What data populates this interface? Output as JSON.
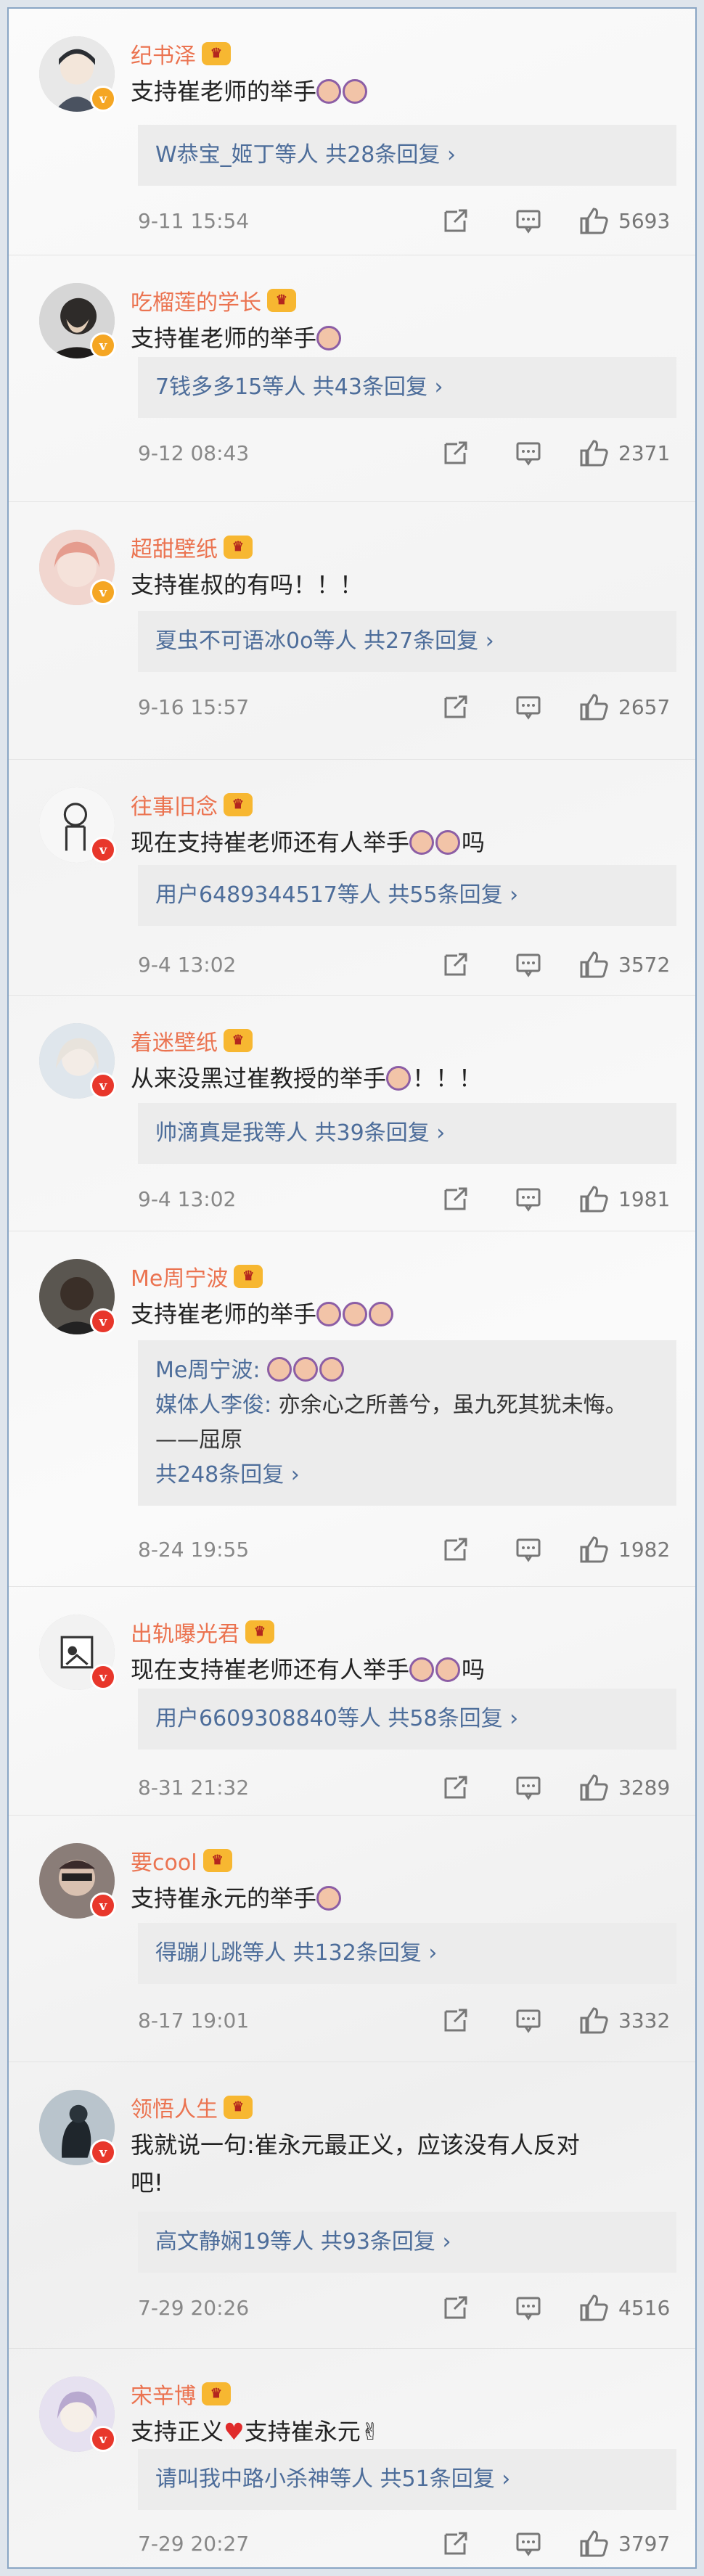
{
  "comments": [
    {
      "username": "纪书泽",
      "badge": "gold",
      "text": "支持崔老师的举手",
      "hands": 2,
      "reply_users": "W恭宝_姬丁等人",
      "reply_total": "共28条回复",
      "time": "9-11 15:54",
      "likes": "5693",
      "avatar_color": "#5b6270"
    },
    {
      "username": "吃榴莲的学长",
      "badge": "gold",
      "text": "支持崔老师的举手",
      "hands": 1,
      "reply_users": "7钱多多15等人",
      "reply_total": "共43条回复",
      "time": "9-12 08:43",
      "likes": "2371",
      "avatar_color": "#3b3836"
    },
    {
      "username": "超甜壁纸",
      "badge": "gold",
      "text": "支持崔叔的有吗！！！",
      "hands": 0,
      "reply_users": "夏虫不可语冰0o等人",
      "reply_total": "共27条回复",
      "time": "9-16 15:57",
      "likes": "2657",
      "avatar_color": "#e9b3a7"
    },
    {
      "username": "往事旧念",
      "badge": "red",
      "text": "现在支持崔老师还有人举手",
      "text_suffix": "吗",
      "hands": 2,
      "reply_users": "用户6489344517等人",
      "reply_total": "共55条回复",
      "time": "9-4 13:02",
      "likes": "3572",
      "avatar_color": "#f4f4f4"
    },
    {
      "username": "着迷壁纸",
      "badge": "red",
      "text": "从来没黑过崔教授的举手",
      "text_suffix": "！！！",
      "hands": 1,
      "reply_users": "帅滴真是我等人",
      "reply_total": "共39条回复",
      "time": "9-4 13:02",
      "likes": "1981",
      "avatar_color": "#c9d3dc"
    },
    {
      "username": "Me周宁波",
      "badge": "red",
      "text": "支持崔老师的举手",
      "hands": 3,
      "reply_lines": [
        {
          "user": "Me周宁波:",
          "text": ""
        },
        {
          "user": "媒体人李俊:",
          "text": "亦余心之所善兮，虽九死其犹未悔。——屈原"
        }
      ],
      "reply_total": "共248条回复",
      "time": "8-24 19:55",
      "likes": "1982",
      "avatar_color": "#3c3a35"
    },
    {
      "username": "出轨曝光君",
      "badge": "red",
      "text": "现在支持崔老师还有人举手",
      "text_suffix": "吗",
      "hands": 2,
      "reply_users": "用户6609308840等人",
      "reply_total": "共58条回复",
      "time": "8-31 21:32",
      "likes": "3289",
      "avatar_color": "#efefef"
    },
    {
      "username": "要cool",
      "badge": "red",
      "text": "支持崔永元的举手",
      "hands": 1,
      "reply_users": "得蹦儿跳等人",
      "reply_total": "共132条回复",
      "time": "8-17 19:01",
      "likes": "3332",
      "avatar_color": "#553b3b"
    },
    {
      "username": "领悟人生",
      "badge": "red",
      "text": "我就说一句:崔永元最正义，应该没有人反对吧!",
      "hands": 0,
      "reply_users": "高文静娴19等人",
      "reply_total": "共93条回复",
      "time": "7-29 20:26",
      "likes": "4516",
      "avatar_color": "#2e3a44"
    },
    {
      "username": "宋辛博",
      "badge": "red",
      "text": "支持正义",
      "text_mid": "支持崔永元",
      "hands": 0,
      "reply_users": "请叫我中路小杀神等人",
      "reply_total": "共51条回复",
      "time": "7-29 20:27",
      "likes": "3797",
      "avatar_color": "#d9d3ea"
    }
  ],
  "icons": {
    "vip": "crown-vip-icon",
    "verified": "verified-v-icon",
    "forward": "forward-icon",
    "comment": "comment-icon",
    "like": "thumb-up-icon"
  }
}
